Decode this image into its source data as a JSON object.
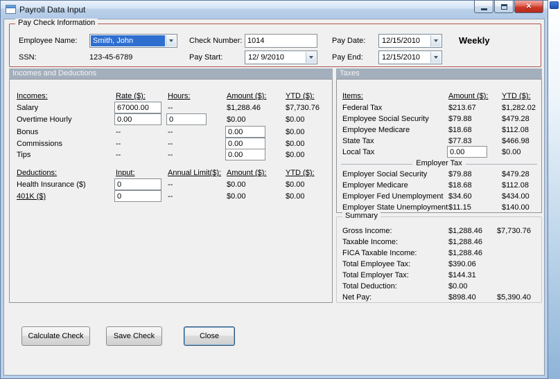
{
  "window": {
    "title": "Payroll Data Input"
  },
  "glyphs": {
    "close": "✕"
  },
  "paycheck": {
    "group_label": "Pay Check Information",
    "employee_name": {
      "label": "Employee Name:",
      "value": "Smith, John"
    },
    "ssn": {
      "label": "SSN:",
      "value": "123-45-6789"
    },
    "check_number": {
      "label": "Check Number:",
      "value": "1014"
    },
    "pay_start": {
      "label": "Pay Start:",
      "value": "12/ 9/2010"
    },
    "pay_date": {
      "label": "Pay Date:",
      "value": "12/15/2010"
    },
    "pay_end": {
      "label": "Pay End:",
      "value": "12/15/2010"
    },
    "frequency": "Weekly"
  },
  "section_headers": {
    "left": "Incomes and Deductions",
    "right": "Taxes"
  },
  "incomes": {
    "headers": {
      "c0": "Incomes:",
      "c1": "Rate ($):",
      "c2": "Hours:",
      "c3": "Amount ($):",
      "c4": "YTD ($):"
    },
    "rows": [
      {
        "label": "Salary",
        "rate": "67000.00",
        "hours": "--",
        "amount": "$1,288.46",
        "ytd": "$7,730.76"
      },
      {
        "label": "Overtime Hourly",
        "rate": "0.00",
        "hours": "0",
        "amount": "$0.00",
        "ytd": "$0.00"
      },
      {
        "label": "Bonus",
        "rate": "--",
        "hours": "--",
        "amount": "0.00",
        "ytd": "$0.00"
      },
      {
        "label": "Commissions",
        "rate": "--",
        "hours": "--",
        "amount": "0.00",
        "ytd": "$0.00"
      },
      {
        "label": "Tips",
        "rate": "--",
        "hours": "--",
        "amount": "0.00",
        "ytd": "$0.00"
      }
    ]
  },
  "deductions": {
    "headers": {
      "c0": "Deductions:",
      "c1": "Input:",
      "c2": "Annual Limit($):",
      "c3": "Amount ($):",
      "c4": "YTD ($):"
    },
    "rows": [
      {
        "label": "Health Insurance  ($)",
        "input": "0",
        "limit": "--",
        "amount": "$0.00",
        "ytd": "$0.00"
      },
      {
        "label": "401K  ($)",
        "input": "0",
        "limit": "--",
        "amount": "$0.00",
        "ytd": "$0.00"
      }
    ]
  },
  "taxes": {
    "headers": {
      "c0": "Items:",
      "c1": "Amount ($):",
      "c2": "YTD ($):"
    },
    "employee_rows": [
      {
        "label": "Federal Tax",
        "amount": "$213.67",
        "ytd": "$1,282.02"
      },
      {
        "label": "Employee Social Security",
        "amount": "$79.88",
        "ytd": "$479.28"
      },
      {
        "label": "Employee Medicare",
        "amount": "$18.68",
        "ytd": "$112.08"
      },
      {
        "label": "State Tax",
        "amount": "$77.83",
        "ytd": "$466.98"
      },
      {
        "label": "Local Tax",
        "amount": "0.00",
        "ytd": "$0.00"
      }
    ],
    "employer_separator": "Employer Tax",
    "employer_rows": [
      {
        "label": "Employer Social Security",
        "amount": "$79.88",
        "ytd": "$479.28"
      },
      {
        "label": "Employer Medicare",
        "amount": "$18.68",
        "ytd": "$112.08"
      },
      {
        "label": "Employer Fed Unemployment",
        "amount": "$34.60",
        "ytd": "$434.00"
      },
      {
        "label": "Employer State Unemployment",
        "amount": "$11.15",
        "ytd": "$140.00"
      }
    ]
  },
  "summary": {
    "group_label": "Summary",
    "rows": [
      {
        "label": "Gross Income:",
        "amount": "$1,288.46",
        "ytd": "$7,730.76"
      },
      {
        "label": "Taxable Income:",
        "amount": "$1,288.46",
        "ytd": ""
      },
      {
        "label": "FICA Taxable Income:",
        "amount": "$1,288.46",
        "ytd": ""
      },
      {
        "label": "Total Employee Tax:",
        "amount": "$390.06",
        "ytd": ""
      },
      {
        "label": "Total Employer Tax:",
        "amount": "$144.31",
        "ytd": ""
      },
      {
        "label": "Total Deduction:",
        "amount": "$0.00",
        "ytd": ""
      },
      {
        "label": "Net Pay:",
        "amount": "$898.40",
        "ytd": "$5,390.40"
      }
    ]
  },
  "buttons": {
    "calculate": "Calculate Check",
    "save": "Save Check",
    "close": "Close"
  },
  "colors": {
    "group_border_red": "#b0544a",
    "section_header_bg": "#a3afbc",
    "combo_highlight": "#2e6fd0",
    "close_button_red": "#cc3a28",
    "titlebar_blue": "#b9cfe9"
  }
}
